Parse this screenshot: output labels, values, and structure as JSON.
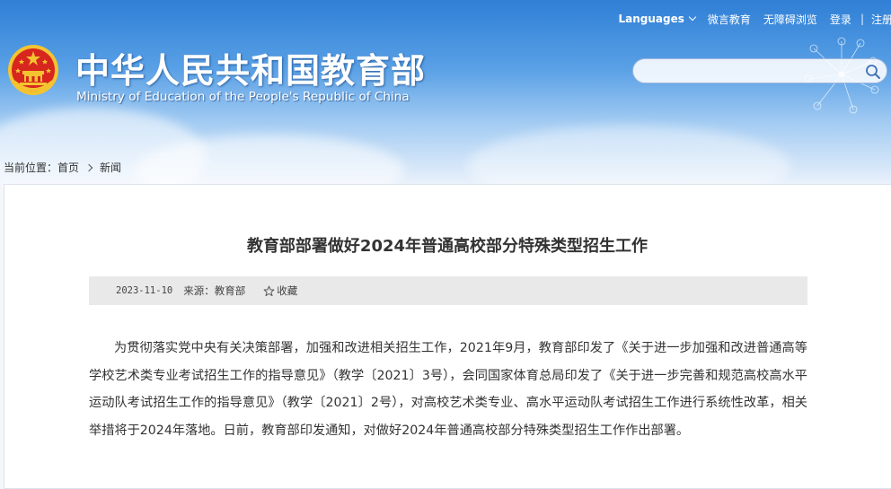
{
  "header": {
    "title_cn": "中华人民共和国教育部",
    "title_en": "Ministry of Education of the People's Republic of China"
  },
  "topnav": {
    "languages": "Languages",
    "items": [
      "微言教育",
      "无障碍浏览",
      "登录",
      "注册"
    ],
    "separator": "|"
  },
  "search": {
    "placeholder": ""
  },
  "breadcrumb": {
    "label": "当前位置：",
    "home": "首页",
    "current": "新闻"
  },
  "article": {
    "title": "教育部部署做好2024年普通高校部分特殊类型招生工作",
    "date": "2023-11-10",
    "source": "来源：教育部",
    "favorite": "收藏",
    "paragraph": "为贯彻落实党中央有关决策部署，加强和改进相关招生工作，2021年9月，教育部印发了《关于进一步加强和改进普通高等学校艺术类专业考试招生工作的指导意见》（教学〔2021〕3号），会同国家体育总局印发了《关于进一步完善和规范高校高水平运动队考试招生工作的指导意见》（教学〔2021〕2号），对高校艺术类专业、高水平运动队考试招生工作进行系统性改革，相关举措将于2024年落地。日前，教育部印发通知，对做好2024年普通高校部分特殊类型招生工作作出部署。"
  },
  "colors": {
    "header_top": "#2f7fd6",
    "header_bottom": "#e9f1fb",
    "emblem_red": "#d7261e",
    "emblem_gold": "#f4c430",
    "meta_bar": "#e9e9e9",
    "text": "#333333"
  },
  "icons": [
    "national-emblem-icon",
    "chevron-down-icon",
    "search-icon",
    "chevron-right-icon",
    "star-icon"
  ]
}
